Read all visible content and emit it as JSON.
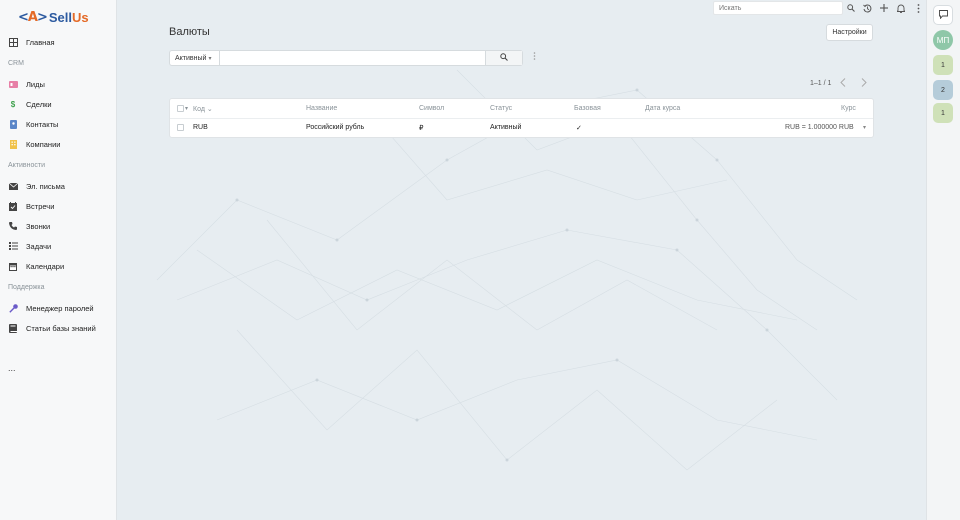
{
  "logo": {
    "mark_left": "<",
    "mark_mid": "A",
    "mark_right": ">",
    "brand_a": "Sell",
    "brand_b": "Us"
  },
  "sidebar": {
    "items": [
      {
        "label": "Главная",
        "icon": "grid-icon"
      },
      {
        "section": "CRM"
      },
      {
        "label": "Лиды",
        "icon": "id-card-icon"
      },
      {
        "label": "Сделки",
        "icon": "dollar-icon"
      },
      {
        "label": "Контакты",
        "icon": "address-book-icon"
      },
      {
        "label": "Компании",
        "icon": "building-icon"
      },
      {
        "section": "Активности"
      },
      {
        "label": "Эл. письма",
        "icon": "envelope-icon"
      },
      {
        "label": "Встречи",
        "icon": "calendar-check-icon"
      },
      {
        "label": "Звонки",
        "icon": "phone-icon"
      },
      {
        "label": "Задачи",
        "icon": "tasks-icon"
      },
      {
        "label": "Календари",
        "icon": "calendar-icon"
      },
      {
        "section": "Поддержка"
      },
      {
        "label": "Менеджер паролей",
        "icon": "key-icon"
      },
      {
        "label": "Статьи базы знаний",
        "icon": "book-icon"
      }
    ],
    "more": "..."
  },
  "topbar": {
    "search_placeholder": "Искать"
  },
  "rail": {
    "avatar": "МП",
    "badges": [
      "1",
      "2",
      "1"
    ]
  },
  "page": {
    "title": "Валюты",
    "settings": "Настройки"
  },
  "filter": {
    "select_value": "Активный"
  },
  "pagination": {
    "text": "1–1 / 1"
  },
  "table": {
    "columns": [
      "Код",
      "Название",
      "Символ",
      "Статус",
      "Базовая",
      "Дата курса",
      "Курс"
    ],
    "rows": [
      {
        "code": "RUB",
        "name": "Российский рубль",
        "symbol": "₽",
        "status": "Активный",
        "base": "✓",
        "rate_date": "",
        "rate": "RUB = 1.000000 RUB"
      }
    ]
  },
  "colors": {
    "accent": "#e46a27",
    "brand": "#2c5aa0",
    "background": "#e7edf1"
  }
}
